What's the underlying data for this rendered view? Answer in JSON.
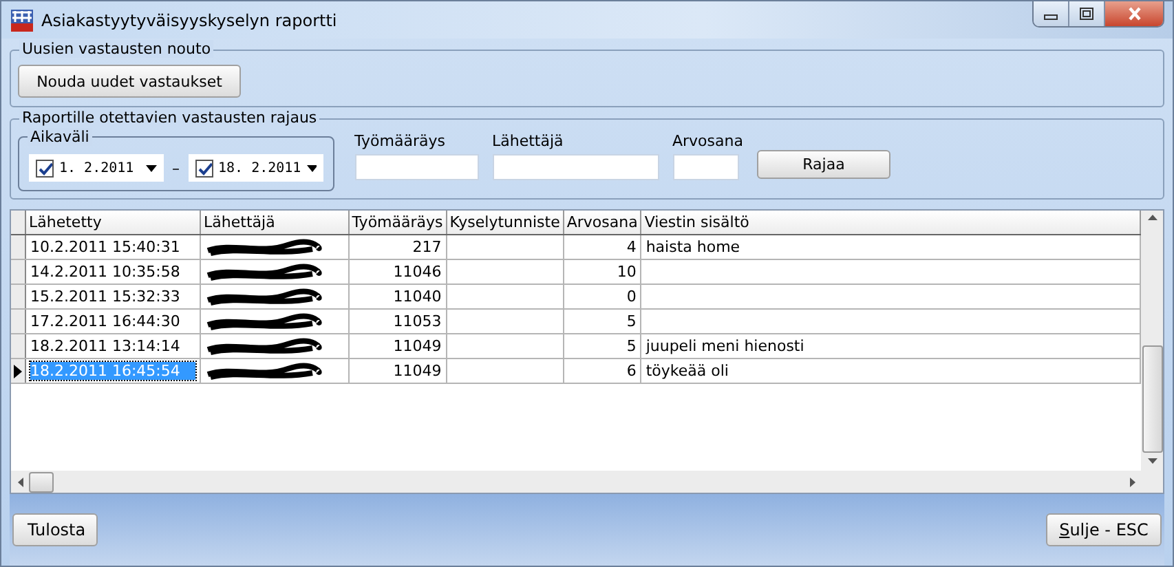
{
  "window": {
    "title": "Asiakastyytyväisyyskyselyn raportti"
  },
  "fetch_group": {
    "title": "Uusien vastausten nouto",
    "button": "Nouda uudet vastaukset"
  },
  "filter_group": {
    "title": "Raportille otettavien vastausten rajaus",
    "date_range": {
      "title": "Aikaväli",
      "separator": "–",
      "from": {
        "checked": true,
        "value": "1. 2.2011"
      },
      "to": {
        "checked": true,
        "value": "18. 2.2011"
      }
    },
    "fields": [
      {
        "label": "Työmääräys"
      },
      {
        "label": "Lähettäjä"
      },
      {
        "label": "Arvosana"
      }
    ],
    "button": "Rajaa"
  },
  "table": {
    "columns": [
      "Lähetetty",
      "Lähettäjä",
      "Työmääräys",
      "Kyselytunniste",
      "Arvosana",
      "Viestin sisältö"
    ],
    "rows": [
      {
        "selected": false,
        "redacted": true,
        "cells": [
          "10.2.2011 15:40:31",
          "",
          "217",
          "",
          "4",
          "haista home"
        ]
      },
      {
        "selected": false,
        "redacted": true,
        "cells": [
          "14.2.2011 10:35:58",
          "",
          "11046",
          "",
          "10",
          ""
        ]
      },
      {
        "selected": false,
        "redacted": true,
        "cells": [
          "15.2.2011 15:32:33",
          "",
          "11040",
          "",
          "0",
          ""
        ]
      },
      {
        "selected": false,
        "redacted": true,
        "cells": [
          "17.2.2011 16:44:30",
          "",
          "11053",
          "",
          "5",
          ""
        ]
      },
      {
        "selected": false,
        "redacted": true,
        "cells": [
          "18.2.2011 13:14:14",
          "",
          "11049",
          "",
          "5",
          "juupeli meni hienosti"
        ]
      },
      {
        "selected": true,
        "redacted": true,
        "cells": [
          "18.2.2011 16:45:54",
          "",
          "11049",
          "",
          "6",
          "töykeää oli"
        ]
      }
    ]
  },
  "buttons": {
    "print": "Tulosta",
    "close": "Sulje - ESC"
  }
}
